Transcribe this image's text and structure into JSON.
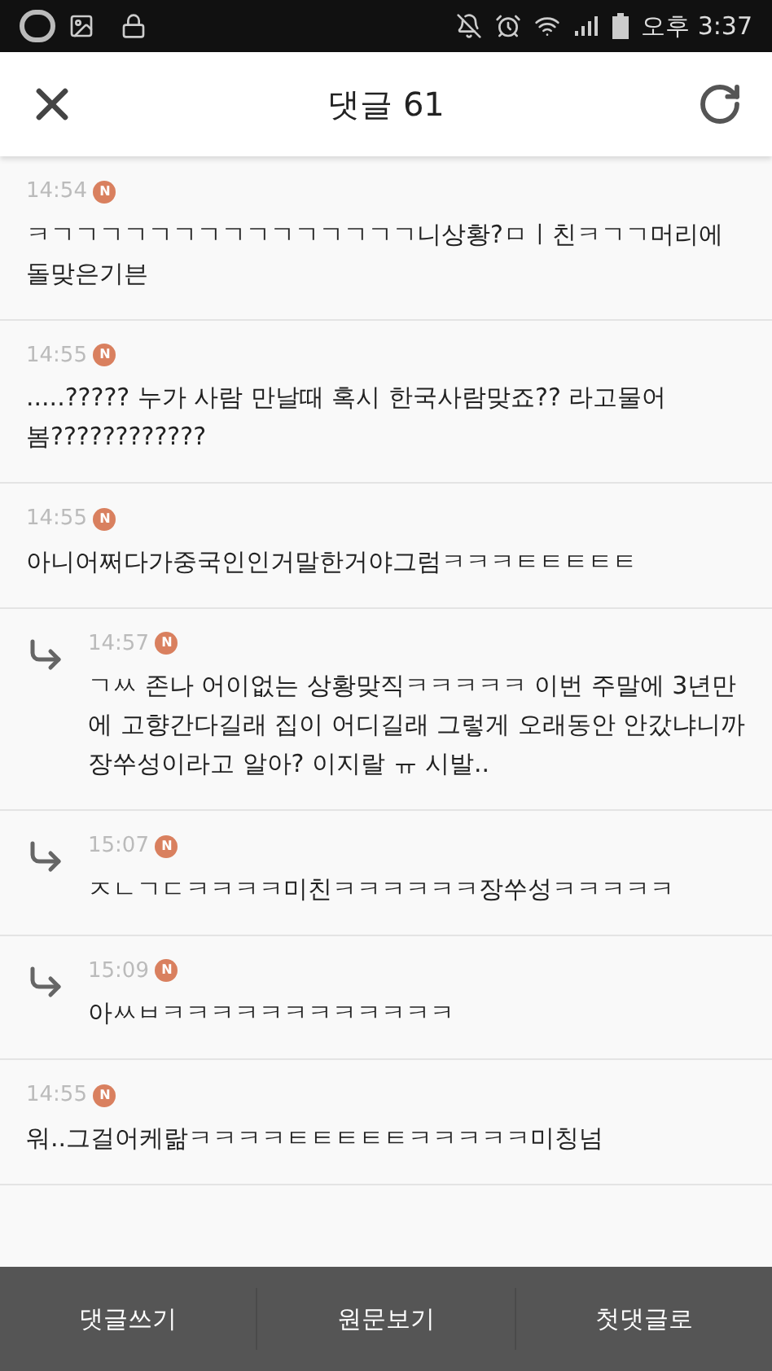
{
  "status_bar": {
    "time": "오후 3:37"
  },
  "header": {
    "title": "댓글 61"
  },
  "comments": [
    {
      "kind": "comment",
      "time": "14:54",
      "badge": "N",
      "text": "ㅋㄱㄱㄱㄱㄱㄱㄱㄱㄱㄱㄱㄱㄱㄱㄱ니상황?ㅁㅣ친ㅋㄱㄱ머리에 돌맞은기븐"
    },
    {
      "kind": "comment",
      "time": "14:55",
      "badge": "N",
      "text": ".....????? 누가 사람 만날때 혹시 한국사람맞죠?? 라고물어봄????????????"
    },
    {
      "kind": "comment",
      "time": "14:55",
      "badge": "N",
      "text": "아니어쩌다가중국인인거말한거야그럼ㅋㅋㅋㅌㅌㅌㅌㅌ"
    },
    {
      "kind": "reply",
      "time": "14:57",
      "badge": "N",
      "text": "ㄱㅆ 존나 어이없는 상황맞직ㅋㅋㅋㅋㅋ 이번 주말에 3년만에 고향간다길래 집이 어디길래 그렇게 오래동안 안갔냐니까 장쑤성이라고 알아? 이지랄 ㅠ 시발.."
    },
    {
      "kind": "reply",
      "time": "15:07",
      "badge": "N",
      "text": "ㅈㄴㄱㄷㅋㅋㅋㅋ미친ㅋㅋㅋㅋㅋㅋ장쑤성ㅋㅋㅋㅋㅋ"
    },
    {
      "kind": "reply",
      "time": "15:09",
      "badge": "N",
      "text": "아ㅆㅂㅋㅋㅋㅋㅋㅋㅋㅋㅋㅋㅋㅋ"
    },
    {
      "kind": "comment",
      "time": "14:55",
      "badge": "N",
      "text": "워..그걸어케랆ㅋㅋㅋㅋㅌㅌㅌㅌㅌㅋㅋㅋㅋㅋ미칭넘"
    }
  ],
  "bottom_bar": [
    "댓글쓰기",
    "원문보기",
    "첫댓글로"
  ]
}
